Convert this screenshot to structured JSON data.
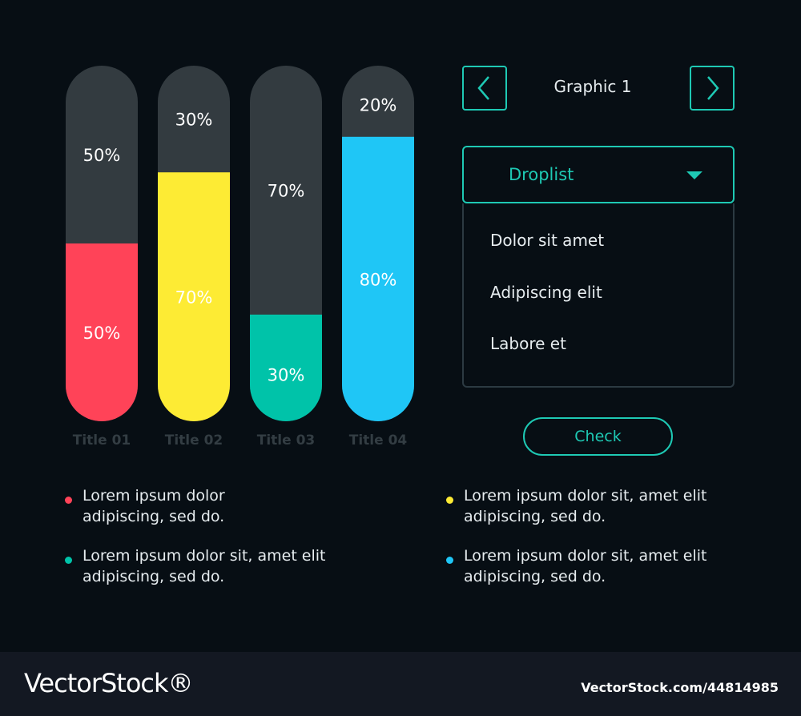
{
  "chart_data": {
    "type": "bar",
    "categories": [
      "Title 01",
      "Title 02",
      "Title 03",
      "Title 04"
    ],
    "values": [
      50,
      70,
      30,
      80
    ],
    "remainder": [
      50,
      30,
      70,
      20
    ],
    "value_labels": [
      "50%",
      "70%",
      "30%",
      "80%"
    ],
    "remainder_labels": [
      "50%",
      "30%",
      "70%",
      "20%"
    ],
    "ylim": [
      0,
      100
    ],
    "colors": [
      "#ff4358",
      "#fdeb34",
      "#00c3a9",
      "#1fc6f6"
    ],
    "track_color": "#333b40"
  },
  "panel": {
    "graphic_title": "Graphic 1",
    "prev_icon": "chevron-left-icon",
    "next_icon": "chevron-right-icon"
  },
  "droplist": {
    "label": "Droplist",
    "caret_icon": "caret-down-icon",
    "items": [
      "Dolor sit amet",
      "Adipiscing elit",
      "Labore et"
    ]
  },
  "check_label": "Check",
  "legend": [
    {
      "text": "Lorem ipsum dolor adipiscing, sed do.",
      "color": "#ff4358"
    },
    {
      "text": "Lorem ipsum dolor sit, amet elit adipiscing, sed do.",
      "color": "#fdeb34"
    },
    {
      "text": "Lorem ipsum dolor sit, amet elit adipiscing, sed do.",
      "color": "#00c3a9"
    },
    {
      "text": "Lorem ipsum dolor sit, amet elit adipiscing, sed do.",
      "color": "#1fc6f6"
    }
  ],
  "footer": {
    "logo": "VectorStock®",
    "image_id": "VectorStock.com/44814985"
  }
}
